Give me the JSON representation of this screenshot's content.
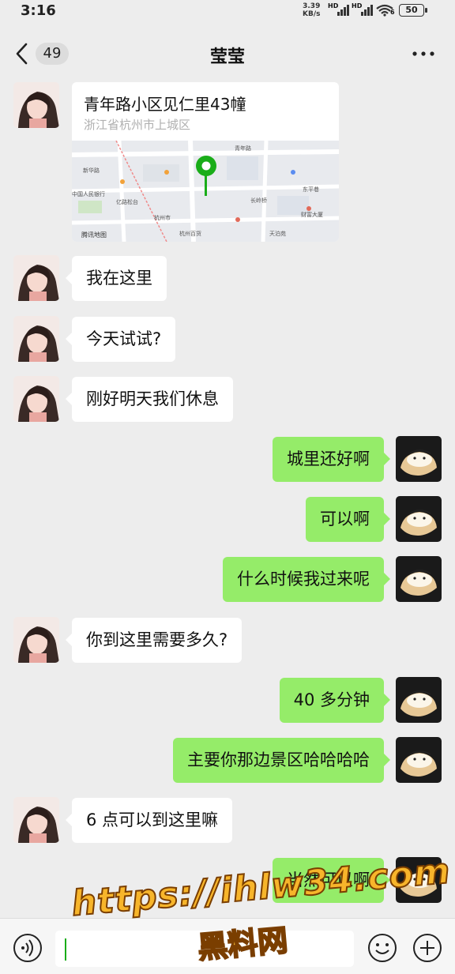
{
  "status_bar": {
    "time": "3:16",
    "net_speed": "3.39",
    "net_unit": "KB/s",
    "hd1": "HD",
    "hd2": "HD",
    "wifi_sub": "6",
    "battery": "50"
  },
  "nav": {
    "unread_count": "49",
    "title": "莹莹",
    "back_icon": "chevron-left-icon",
    "more_icon": "more-dots-icon"
  },
  "location_card": {
    "title": "青年路小区见仁里43幢",
    "address": "浙江省杭州市上城区",
    "map_labels": [
      "新华路",
      "青年路",
      "东平巷",
      "腾讯地图",
      "中国人民银行",
      "亿路松台",
      "杭州市",
      "长岭桥",
      "财富大厦",
      "天泊苑",
      "杭州百货"
    ],
    "pin_color": "#1aad19"
  },
  "messages": [
    {
      "side": "left",
      "text": "我在这里"
    },
    {
      "side": "left",
      "text": "今天试试?"
    },
    {
      "side": "left",
      "text": "刚好明天我们休息"
    },
    {
      "side": "right",
      "text": "城里还好啊"
    },
    {
      "side": "right",
      "text": "可以啊"
    },
    {
      "side": "right",
      "text": "什么时候我过来呢"
    },
    {
      "side": "left",
      "text": "你到这里需要多久?"
    },
    {
      "side": "right",
      "text": "40 多分钟"
    },
    {
      "side": "right",
      "text": "主要你那边景区哈哈哈哈"
    },
    {
      "side": "left",
      "text": "6 点可以到这里嘛"
    },
    {
      "side": "right",
      "text": "当然可以啊"
    }
  ],
  "input_bar": {
    "voice_icon": "voice-icon",
    "emoji_icon": "emoji-icon",
    "plus_icon": "plus-icon"
  },
  "watermark": {
    "url": "https://ihlw34.com",
    "name": "黑料网"
  },
  "colors": {
    "background": "#ededed",
    "bubble_self": "#95ec69",
    "bubble_other": "#ffffff",
    "watermark": "#f7b52b"
  }
}
